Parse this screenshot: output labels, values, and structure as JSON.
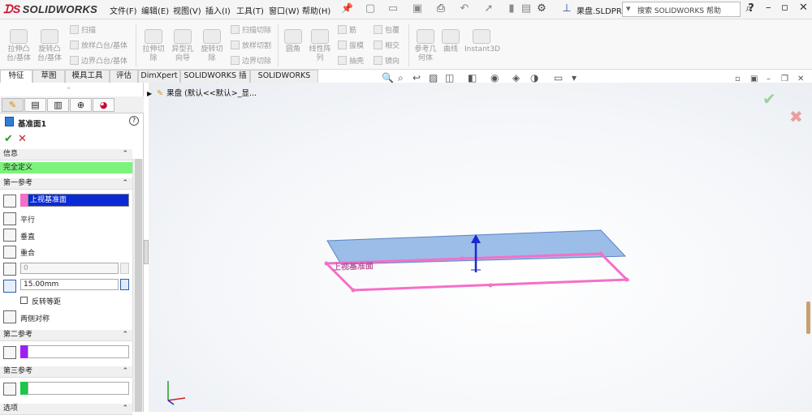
{
  "app": {
    "logo": "SOLIDWORKS",
    "doc_title": "果盘.SLDPR...",
    "search_placeholder": "搜索 SOLIDWORKS 帮助"
  },
  "menu": [
    "文件(F)",
    "编辑(E)",
    "视图(V)",
    "插入(I)",
    "工具(T)",
    "窗口(W)",
    "帮助(H)"
  ],
  "commands": {
    "extrude_boss": "拉伸凸\n台/基体",
    "revolve_boss": "旋转凸\n台/基体",
    "sweep": "扫描",
    "loft_boss": "放样凸台/基体",
    "boundary_boss": "边界凸台/基体",
    "extrude_cut": "拉伸切\n除",
    "hole_wizard": "异型孔\n向导",
    "revolve_cut": "旋转切\n除",
    "sweep_cut": "扫描切除",
    "loft_cut": "放样切割",
    "boundary_cut": "边界切除",
    "fillet": "圆角",
    "linear_pattern": "线性阵\n列",
    "rib": "筋",
    "draft": "拔模",
    "shell": "抽壳",
    "wrap": "包覆",
    "intersect": "相交",
    "mirror": "镜向",
    "ref_geometry": "参考几\n何体",
    "curves": "曲线",
    "instant3d": "Instant3D"
  },
  "tabs": [
    "特征",
    "草图",
    "模具工具",
    "评估",
    "DimXpert",
    "SOLIDWORKS 插件",
    "SOLIDWORKS MBD"
  ],
  "tree": {
    "label": "果盘  (默认<<默认>_显..."
  },
  "panel": {
    "title": "基准面1",
    "info_header": "信息",
    "status": "完全定义",
    "first_ref_header": "第一参考",
    "first_ref_value": "上视基准面",
    "parallel": "平行",
    "perpendicular": "垂直",
    "coincident": "重合",
    "angle_value": "0",
    "offset_value": "15.00mm",
    "flip_offset": "反转等距",
    "mid_plane": "两侧对称",
    "second_ref_header": "第二参考",
    "third_ref_header": "第三参考",
    "options_header": "选项"
  },
  "viewport": {
    "plane_label": "上视基准面"
  },
  "colors": {
    "status_green": "#7cf37c",
    "first_ref_color": "#f56fc8",
    "second_ref_color": "#9d1ff5",
    "third_ref_color": "#1fc44a",
    "selection_blue": "#0a2ad6",
    "plane_blue": "#7ba8e0"
  }
}
